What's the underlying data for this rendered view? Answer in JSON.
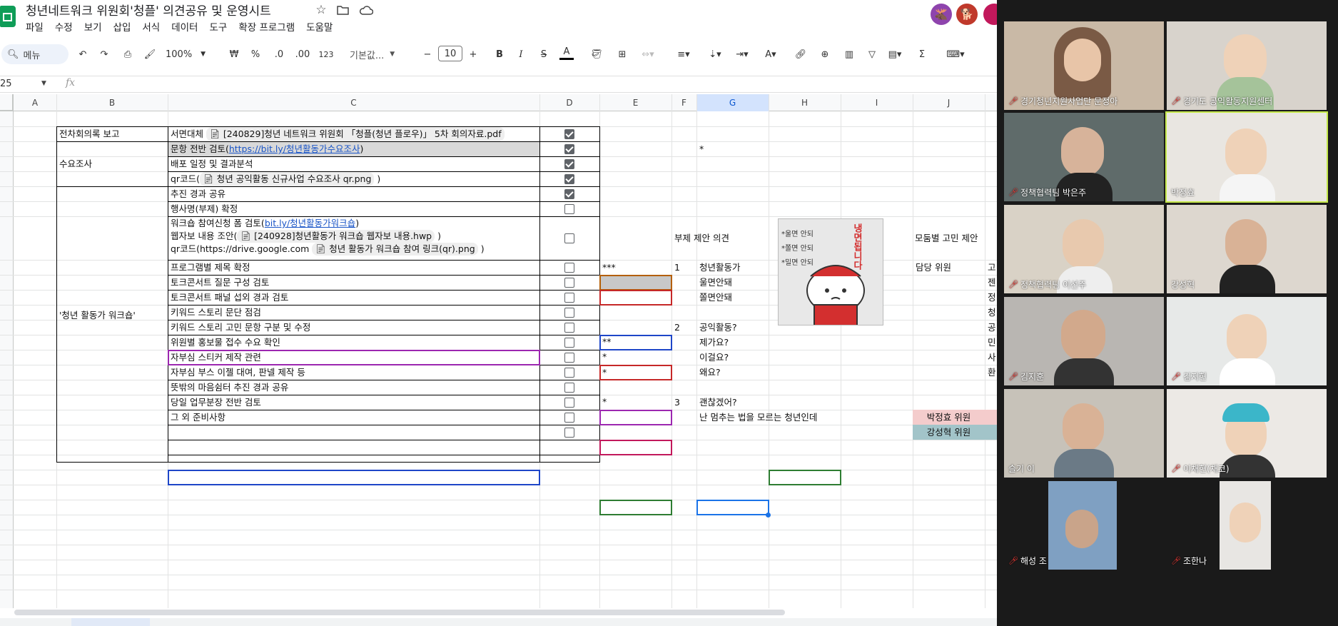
{
  "doc": {
    "title": "청년네트워크 위원회'청플' 의견공유 및 운영시트"
  },
  "menu": [
    "파일",
    "수정",
    "보기",
    "삽입",
    "서식",
    "데이터",
    "도구",
    "확장 프로그램",
    "도움말"
  ],
  "toolbar": {
    "search_placeholder": "메뉴",
    "zoom": "100%",
    "currency": "₩",
    "percent": "%",
    "dec_less": ".0",
    "dec_more": ".00",
    "format123": "123",
    "font": "기본값...",
    "font_size": "10",
    "bold": "B",
    "italic": "I",
    "strike": "S",
    "textcolor": "A",
    "sum": "Σ"
  },
  "formula": {
    "cell_ref": "25",
    "fx": "fx"
  },
  "columns": [
    "A",
    "B",
    "C",
    "D",
    "E",
    "F",
    "G",
    "H",
    "I",
    "J"
  ],
  "sections": {
    "s1": "전차회의록 보고",
    "s2": "수요조사",
    "s3": "'청년 활동가 워크숍'"
  },
  "tasks": {
    "r1": "서면대체",
    "r1_chip": "[240829]청년 네트워크 위원회 「청플(청년 플로우)」 5차 회의자료.pdf",
    "r2": "문항 전반 검토(",
    "r2_link": "https://bit.ly/청년활동가수요조사",
    "r2_end": ")",
    "r3": "배포 일정 및 결과분석",
    "r4": "qr코드(",
    "r4_chip": "청년 공익활동 신규사업 수요조사 qr.png",
    "r4_end": ")",
    "r5": "추진 경과 공유",
    "r6": "행사명(부제) 확정",
    "r7a": "워크숍 참여신청 폼 검토(",
    "r7a_link": "bit.ly/청년활동가워크숍",
    "r7a_end": ")",
    "r7b": "웹자보 내용 조안(",
    "r7b_chip": "[240928]청년활동가 워크숍 웹자보 내용.hwp",
    "r7b_end": ")",
    "r7c": "qr코드(https://drive.google.com",
    "r7c_chip": "청년 활동가 워크숍 참여 링크(qr).png",
    "r7c_end": ")",
    "r8": "프로그램별 제목 확정",
    "r9": "토크콘서트 질문 구성 검토",
    "r10": "토크콘서트 패널 섭외 경과 검토",
    "r11": "키워드 스토리 문단 점검",
    "r12": "키워드 스토리 고민 문항 구분 및 수정",
    "r13": "위원별 홍보물 접수 수요 확인",
    "r14": "자부심 스티커 제작 관련",
    "r15": "자부심 부스 이젤 대여, 판넬 제작 등",
    "r16": "뜻밖의 마음쉼터 추진 경과 공유",
    "r17": "당일 업무분장 전반 검토",
    "r18": "그 외 준비사항"
  },
  "checks": [
    true,
    true,
    true,
    true,
    true,
    false,
    false,
    false,
    false,
    false,
    false,
    false,
    false,
    false,
    false,
    false,
    false,
    false,
    false
  ],
  "side": {
    "star_g": "*",
    "subtitle_header": "부제 제안 의견",
    "group_header": "모둠별 고민 제안",
    "stars_e1": "***",
    "stars_e2": "**",
    "star_e3": "*",
    "star_e4": "*",
    "star_e5": "*",
    "n1": "1",
    "n2": "2",
    "n3": "3",
    "g1": "청년활동가",
    "g2": "울면안돼",
    "g3": "쫄면안돼",
    "g4": "공익활동?",
    "g5": "제가요?",
    "g6": "이걸요?",
    "g7": "왜요?",
    "g8": "괜찮겠어?",
    "g9": "난 멈추는 법을 모르는 청년인데",
    "j1": "담당 위원",
    "j2": "박정효 위원",
    "j3": "강성혁 위원",
    "k1": "고",
    "k2": "젠",
    "k3": "정",
    "k4": "청",
    "k5": "공",
    "k6": "민",
    "k7": "사",
    "k8": "환"
  },
  "sticker": {
    "lines": [
      "*울면 안되",
      "*쫄면 안되",
      "*밀면 안되"
    ],
    "slogan": "냉면됩니다"
  },
  "participants": [
    {
      "name": "경기청년지원사업단 문정아",
      "muted": true
    },
    {
      "name": "경기도 공익활동지원센터",
      "muted": true
    },
    {
      "name": "정책협력팀 박은주",
      "muted": true
    },
    {
      "name": "박정효",
      "muted": false
    },
    {
      "name": "정책협력팀 이선주",
      "muted": true
    },
    {
      "name": "강성혁",
      "muted": false
    },
    {
      "name": "김지훈",
      "muted": true
    },
    {
      "name": "김지현",
      "muted": true
    },
    {
      "name": "슬기 이",
      "muted": false
    },
    {
      "name": "이채현(채코)",
      "muted": true
    },
    {
      "name": "해성 조",
      "muted": true
    },
    {
      "name": "조한나",
      "muted": true
    }
  ],
  "colors": {
    "accent": "#1a73e8",
    "green_logo": "#0f9d58",
    "zoom_bg": "#1a1a1a",
    "purple": "#9c27b0",
    "red": "#c62828",
    "blue": "#1e46c8",
    "green": "#2e7d32",
    "pink": "#f4cccc",
    "teal": "#a2c4c9"
  }
}
